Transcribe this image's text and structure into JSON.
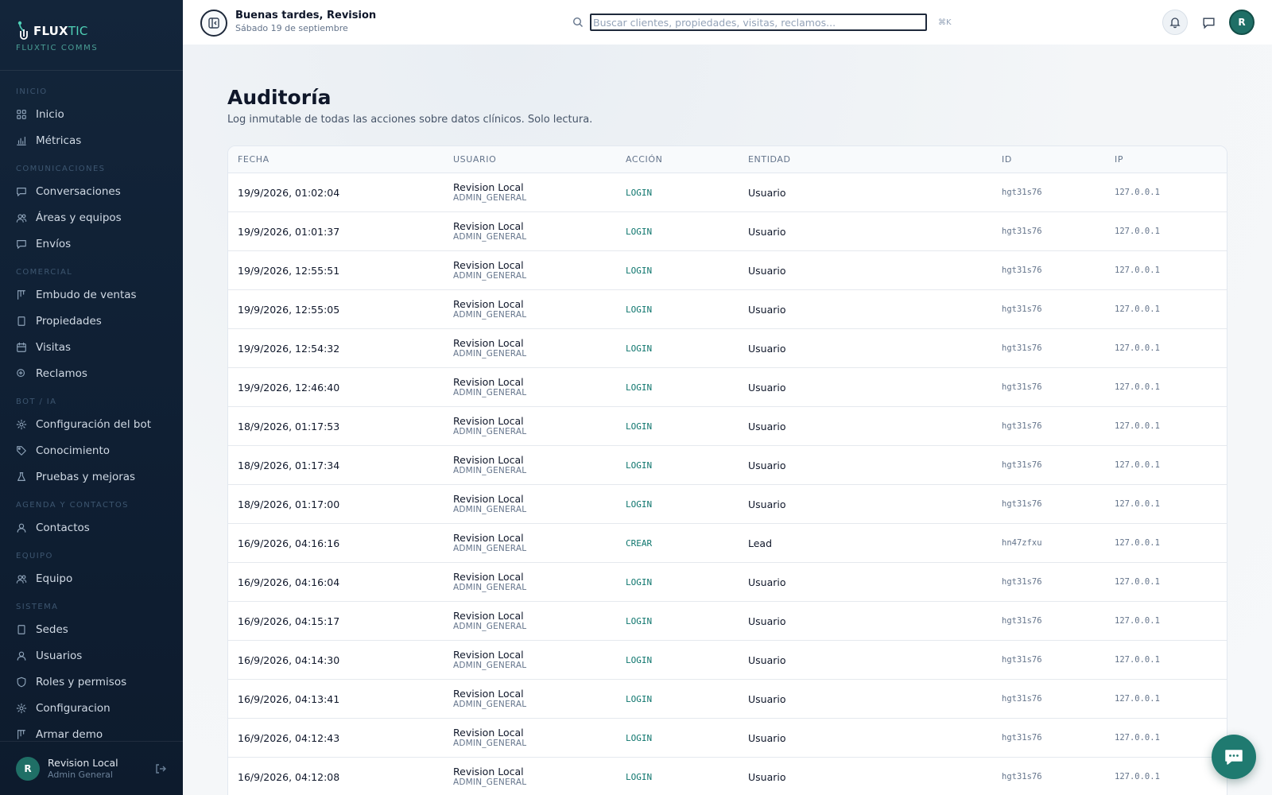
{
  "brand": {
    "name_a": "FLUX",
    "name_b": "TIC",
    "subtitle": "FLUXTIC COMMS"
  },
  "sidebar": {
    "sections": [
      {
        "title": "INICIO",
        "items": [
          {
            "label": "Inicio",
            "icon": "grid-icon"
          },
          {
            "label": "Métricas",
            "icon": "bar-chart-icon"
          }
        ]
      },
      {
        "title": "COMUNICACIONES",
        "items": [
          {
            "label": "Conversaciones",
            "icon": "message-icon"
          },
          {
            "label": "Áreas y equipos",
            "icon": "users-icon"
          },
          {
            "label": "Envíos",
            "icon": "message-icon"
          }
        ]
      },
      {
        "title": "COMERCIAL",
        "items": [
          {
            "label": "Embudo de ventas",
            "icon": "kanban-icon"
          },
          {
            "label": "Propiedades",
            "icon": "building-icon"
          },
          {
            "label": "Visitas",
            "icon": "calendar-icon"
          },
          {
            "label": "Reclamos",
            "icon": "search-icon"
          }
        ]
      },
      {
        "title": "BOT / IA",
        "items": [
          {
            "label": "Configuración del bot",
            "icon": "gear-icon"
          },
          {
            "label": "Conocimiento",
            "icon": "tag-icon"
          },
          {
            "label": "Pruebas y mejoras",
            "icon": "flask-icon"
          }
        ]
      },
      {
        "title": "AGENDA Y CONTACTOS",
        "items": [
          {
            "label": "Contactos",
            "icon": "user-icon"
          }
        ]
      },
      {
        "title": "EQUIPO",
        "items": [
          {
            "label": "Equipo",
            "icon": "users-icon"
          }
        ]
      },
      {
        "title": "SISTEMA",
        "items": [
          {
            "label": "Sedes",
            "icon": "building-icon"
          },
          {
            "label": "Usuarios",
            "icon": "user-icon"
          },
          {
            "label": "Roles y permisos",
            "icon": "shield-icon"
          },
          {
            "label": "Configuracion",
            "icon": "gear-icon"
          },
          {
            "label": "Armar demo",
            "icon": "kanban-icon"
          }
        ]
      }
    ],
    "user": {
      "initial": "R",
      "name": "Revision Local",
      "role": "Admin General"
    }
  },
  "topbar": {
    "greeting": "Buenas tardes, Revision",
    "date": "Sábado 19 de septiembre",
    "search_placeholder": "Buscar clientes, propiedades, visitas, reclamos...",
    "search_value": "",
    "shortcut": "⌘K",
    "avatar_initial": "R"
  },
  "page": {
    "title": "Auditoría",
    "subtitle": "Log inmutable de todas las acciones sobre datos clínicos. Solo lectura."
  },
  "table": {
    "headers": [
      "FECHA",
      "USUARIO",
      "ACCIÓN",
      "ENTIDAD",
      "ID",
      "IP"
    ],
    "rows": [
      {
        "date": "19/9/2026, 01:02:04",
        "user": "Revision Local",
        "role": "ADMIN_GENERAL",
        "action": "LOGIN",
        "entity": "Usuario",
        "id": "hgt31s76",
        "ip": "127.0.0.1"
      },
      {
        "date": "19/9/2026, 01:01:37",
        "user": "Revision Local",
        "role": "ADMIN_GENERAL",
        "action": "LOGIN",
        "entity": "Usuario",
        "id": "hgt31s76",
        "ip": "127.0.0.1"
      },
      {
        "date": "19/9/2026, 12:55:51",
        "user": "Revision Local",
        "role": "ADMIN_GENERAL",
        "action": "LOGIN",
        "entity": "Usuario",
        "id": "hgt31s76",
        "ip": "127.0.0.1"
      },
      {
        "date": "19/9/2026, 12:55:05",
        "user": "Revision Local",
        "role": "ADMIN_GENERAL",
        "action": "LOGIN",
        "entity": "Usuario",
        "id": "hgt31s76",
        "ip": "127.0.0.1"
      },
      {
        "date": "19/9/2026, 12:54:32",
        "user": "Revision Local",
        "role": "ADMIN_GENERAL",
        "action": "LOGIN",
        "entity": "Usuario",
        "id": "hgt31s76",
        "ip": "127.0.0.1"
      },
      {
        "date": "19/9/2026, 12:46:40",
        "user": "Revision Local",
        "role": "ADMIN_GENERAL",
        "action": "LOGIN",
        "entity": "Usuario",
        "id": "hgt31s76",
        "ip": "127.0.0.1"
      },
      {
        "date": "18/9/2026, 01:17:53",
        "user": "Revision Local",
        "role": "ADMIN_GENERAL",
        "action": "LOGIN",
        "entity": "Usuario",
        "id": "hgt31s76",
        "ip": "127.0.0.1"
      },
      {
        "date": "18/9/2026, 01:17:34",
        "user": "Revision Local",
        "role": "ADMIN_GENERAL",
        "action": "LOGIN",
        "entity": "Usuario",
        "id": "hgt31s76",
        "ip": "127.0.0.1"
      },
      {
        "date": "18/9/2026, 01:17:00",
        "user": "Revision Local",
        "role": "ADMIN_GENERAL",
        "action": "LOGIN",
        "entity": "Usuario",
        "id": "hgt31s76",
        "ip": "127.0.0.1"
      },
      {
        "date": "16/9/2026, 04:16:16",
        "user": "Revision Local",
        "role": "ADMIN_GENERAL",
        "action": "CREAR",
        "entity": "Lead",
        "id": "hn47zfxu",
        "ip": "127.0.0.1"
      },
      {
        "date": "16/9/2026, 04:16:04",
        "user": "Revision Local",
        "role": "ADMIN_GENERAL",
        "action": "LOGIN",
        "entity": "Usuario",
        "id": "hgt31s76",
        "ip": "127.0.0.1"
      },
      {
        "date": "16/9/2026, 04:15:17",
        "user": "Revision Local",
        "role": "ADMIN_GENERAL",
        "action": "LOGIN",
        "entity": "Usuario",
        "id": "hgt31s76",
        "ip": "127.0.0.1"
      },
      {
        "date": "16/9/2026, 04:14:30",
        "user": "Revision Local",
        "role": "ADMIN_GENERAL",
        "action": "LOGIN",
        "entity": "Usuario",
        "id": "hgt31s76",
        "ip": "127.0.0.1"
      },
      {
        "date": "16/9/2026, 04:13:41",
        "user": "Revision Local",
        "role": "ADMIN_GENERAL",
        "action": "LOGIN",
        "entity": "Usuario",
        "id": "hgt31s76",
        "ip": "127.0.0.1"
      },
      {
        "date": "16/9/2026, 04:12:43",
        "user": "Revision Local",
        "role": "ADMIN_GENERAL",
        "action": "LOGIN",
        "entity": "Usuario",
        "id": "hgt31s76",
        "ip": "127.0.0.1"
      },
      {
        "date": "16/9/2026, 04:12:08",
        "user": "Revision Local",
        "role": "ADMIN_GENERAL",
        "action": "LOGIN",
        "entity": "Usuario",
        "id": "hgt31s76",
        "ip": "127.0.0.1"
      }
    ]
  },
  "colors": {
    "sidebar_bg": "#13253a",
    "accent": "#1f7a70",
    "action_text": "#0f766e"
  }
}
